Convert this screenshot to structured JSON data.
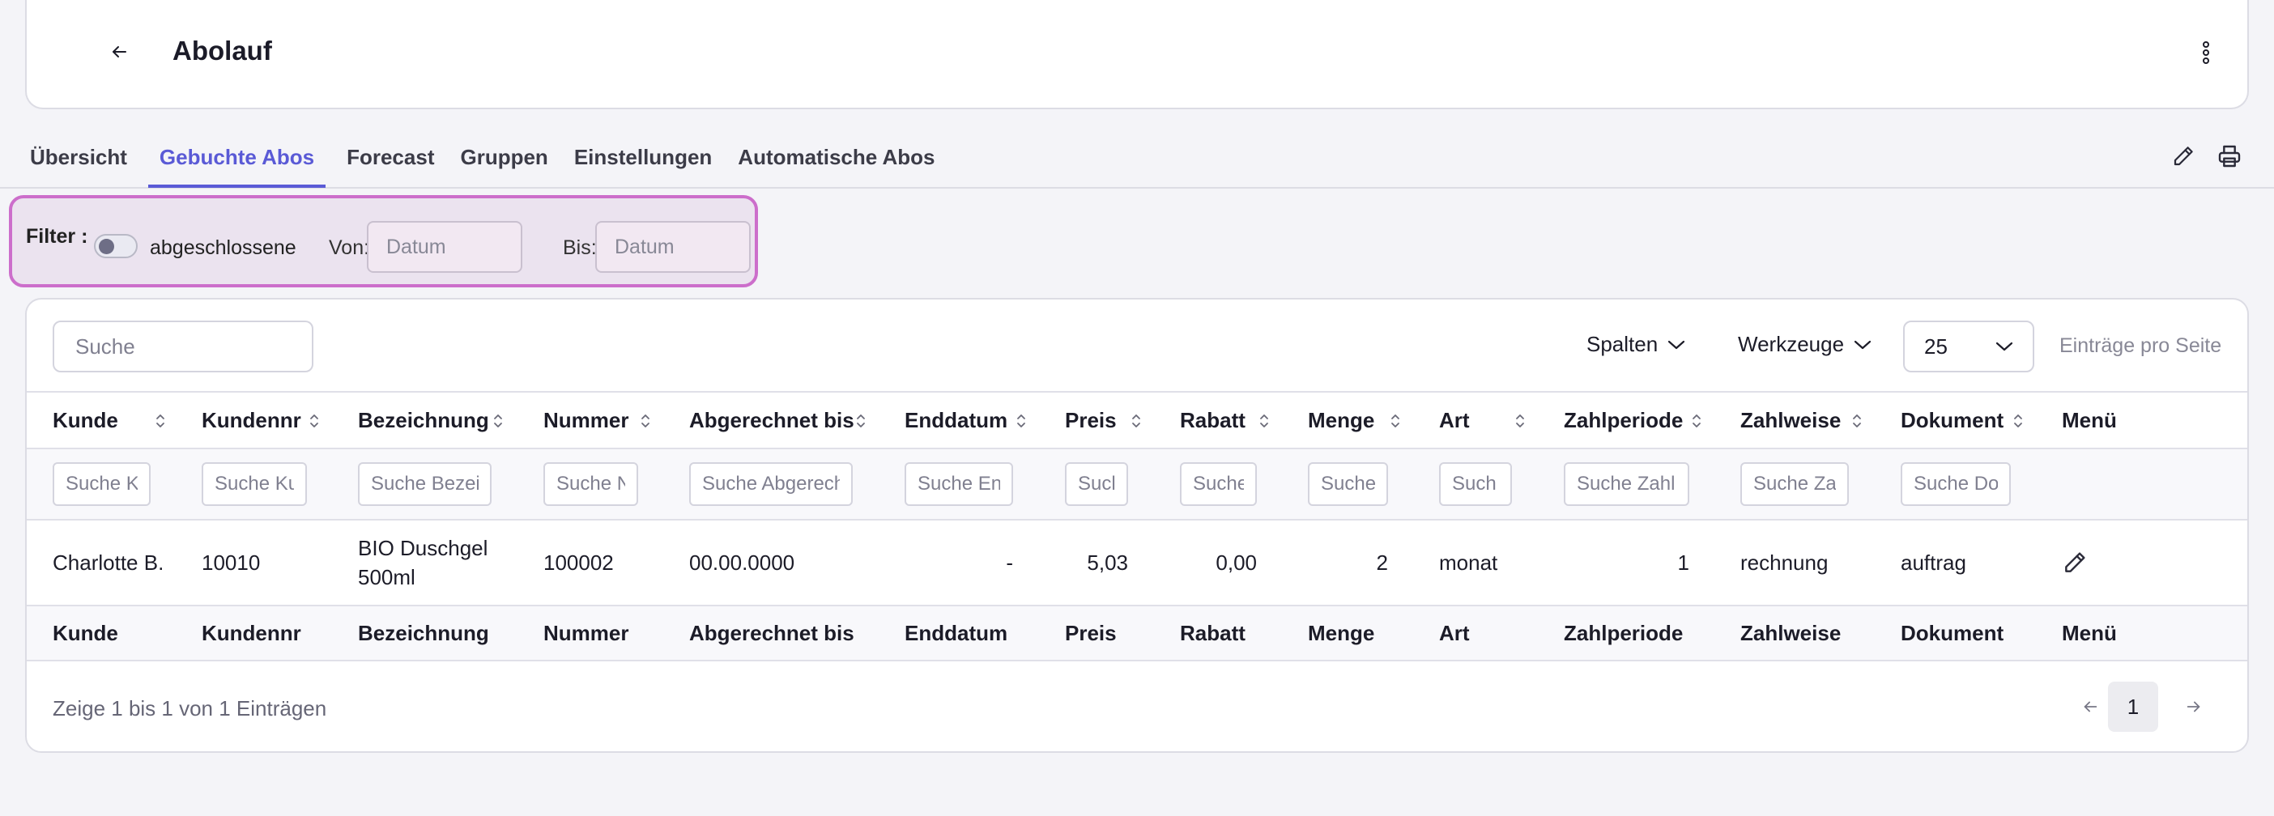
{
  "header": {
    "title": "Abolauf"
  },
  "tabs": [
    {
      "label": "Übersicht"
    },
    {
      "label": "Gebuchte Abos",
      "active": true
    },
    {
      "label": "Forecast"
    },
    {
      "label": "Gruppen"
    },
    {
      "label": "Einstellungen"
    },
    {
      "label": "Automatische Abos"
    }
  ],
  "filter": {
    "label": "Filter :",
    "toggle_label": "abgeschlossene",
    "from_label": "Von:",
    "to_label": "Bis:",
    "date_placeholder": "Datum"
  },
  "toolbar": {
    "search_placeholder": "Suche",
    "columns_label": "Spalten",
    "tools_label": "Werkzeuge",
    "per_page_value": "25",
    "per_page_label": "Einträge pro Seite"
  },
  "table": {
    "columns": [
      "Kunde",
      "Kundennr",
      "Bezeichnung",
      "Nummer",
      "Abgerechnet bis",
      "Enddatum",
      "Preis",
      "Rabatt",
      "Menge",
      "Art",
      "Zahlperiode",
      "Zahlweise",
      "Dokument",
      "Menü"
    ],
    "search_placeholders": [
      "Suche K",
      "Suche Ku",
      "Suche Bezei",
      "Suche N",
      "Suche Abgerech",
      "Suche En",
      "Sucl",
      "Suche",
      "Suche",
      "Such",
      "Suche Zahl",
      "Suche Za",
      "Suche Do"
    ],
    "rows": [
      {
        "kunde": "Charlotte B.",
        "kundennr": "10010",
        "bezeichnung": "BIO Duschgel 500ml",
        "nummer": "100002",
        "abgerechnet_bis": "00.00.0000",
        "enddatum": "-",
        "preis": "5,03",
        "rabatt": "0,00",
        "menge": "2",
        "art": "monat",
        "zahlperiode": "1",
        "zahlweise": "rechnung",
        "dokument": "auftrag"
      }
    ]
  },
  "pagination": {
    "info": "Zeige 1 bis 1 von 1 Einträgen",
    "current_page": "1"
  },
  "colors": {
    "accent": "#5a5ad6",
    "highlight_border": "#cc6ecb"
  },
  "icons": [
    "arrow-left-icon",
    "more-vertical-icon",
    "pencil-icon",
    "printer-icon",
    "chevron-down-icon",
    "sort-icon",
    "edit-icon",
    "arrow-right-icon"
  ]
}
